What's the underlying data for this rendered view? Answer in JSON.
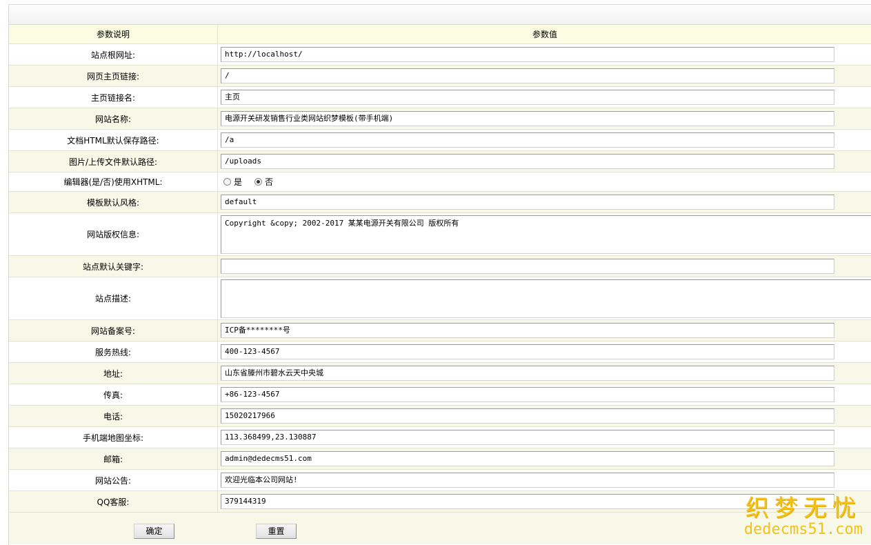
{
  "header": {
    "col_label": "参数说明",
    "col_value": "参数值"
  },
  "rows": [
    {
      "label": "站点根网址:",
      "value": "http://localhost/"
    },
    {
      "label": "网页主页链接:",
      "value": "/"
    },
    {
      "label": "主页链接名:",
      "value": "主页"
    },
    {
      "label": "网站名称:",
      "value": "电源开关研发销售行业类网站织梦模板(带手机端)"
    },
    {
      "label": "文档HTML默认保存路径:",
      "value": "/a"
    },
    {
      "label": "图片/上传文件默认路径:",
      "value": "/uploads"
    },
    {
      "label": "编辑器(是/否)使用XHTML:",
      "options": [
        "是",
        "否"
      ],
      "selected": "否"
    },
    {
      "label": "模板默认风格:",
      "value": "default"
    },
    {
      "label": "网站版权信息:",
      "value": "Copyright &copy; 2002-2017 某某电源开关有限公司 版权所有"
    },
    {
      "label": "站点默认关键字:",
      "value": ""
    },
    {
      "label": "站点描述:",
      "value": ""
    },
    {
      "label": "网站备案号:",
      "value": "ICP备********号"
    },
    {
      "label": "服务热线:",
      "value": "400-123-4567"
    },
    {
      "label": "地址:",
      "value": "山东省滕州市碧水云天中央城"
    },
    {
      "label": "传真:",
      "value": "+86-123-4567"
    },
    {
      "label": "电话:",
      "value": "15020217966"
    },
    {
      "label": "手机端地图坐标:",
      "value": "113.368499,23.130887"
    },
    {
      "label": "邮箱:",
      "value": "admin@dedecms51.com"
    },
    {
      "label": "网站公告:",
      "value": "欢迎光临本公司网站!"
    },
    {
      "label": "QQ客服:",
      "value": "379144319"
    }
  ],
  "buttons": {
    "submit_label": "确定",
    "reset_label": "重置"
  },
  "watermark": {
    "cn": "织梦无忧",
    "en": "dedecms51.com"
  },
  "colors": {
    "header_bg": "#fbfce2",
    "stripe_bg": "#f7f8e8",
    "watermark": "#f0c21a"
  }
}
